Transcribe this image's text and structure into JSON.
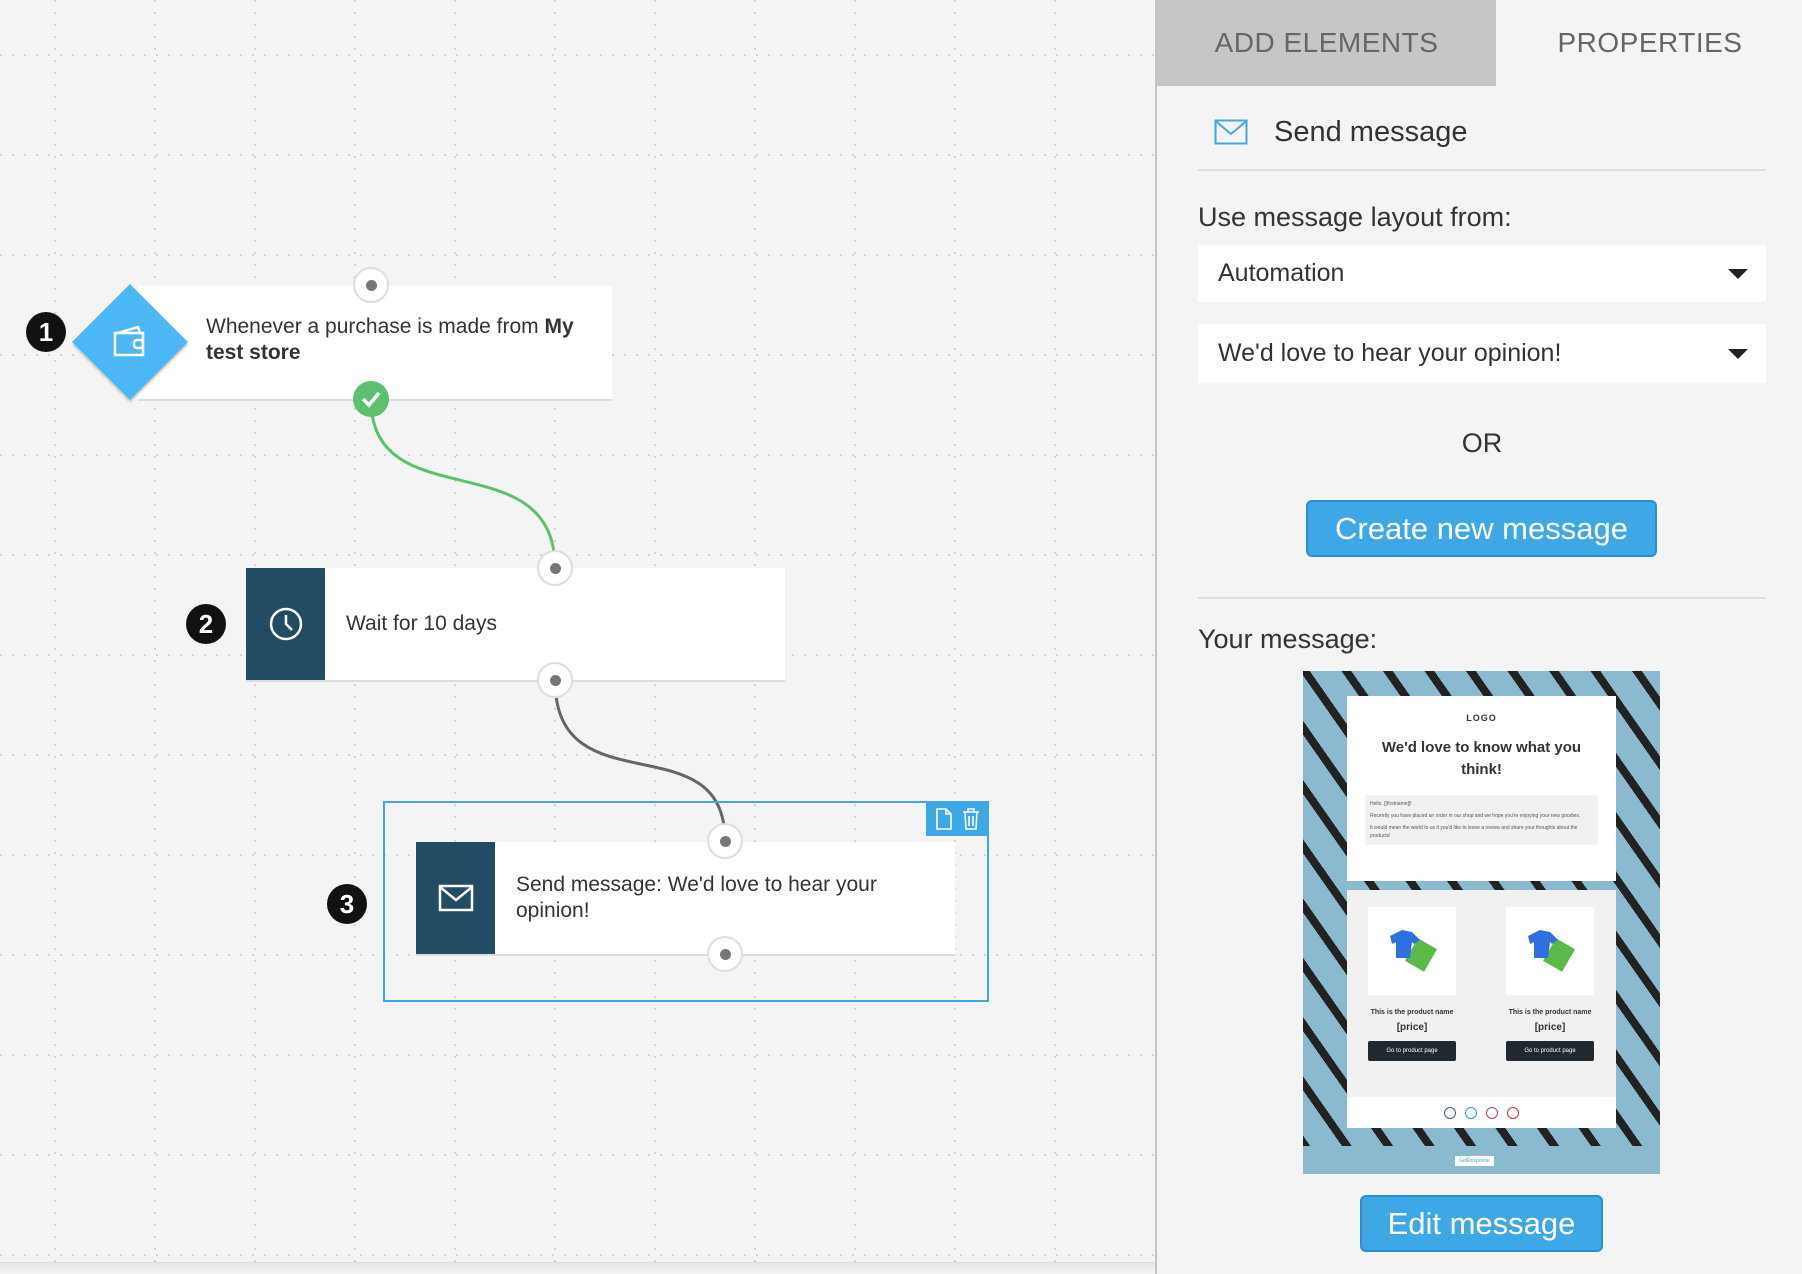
{
  "canvas": {
    "nodes": [
      {
        "number": "1",
        "type": "trigger",
        "text": "Whenever a purchase is made from ",
        "bold": "My test store",
        "icon": "wallet-icon"
      },
      {
        "number": "2",
        "type": "wait",
        "text": "Wait for 10 days",
        "icon": "clock-icon"
      },
      {
        "number": "3",
        "type": "action",
        "text": "Send message: We'd love to hear your opinion!",
        "icon": "envelope-icon",
        "selected": true
      }
    ],
    "colors": {
      "trigger": "#4db6f4",
      "node_icon_bg": "#234b63",
      "success": "#5cc16e",
      "selection": "#3ea8e6"
    }
  },
  "panel": {
    "tabs": [
      {
        "label": "ADD ELEMENTS",
        "active": false
      },
      {
        "label": "PROPERTIES",
        "active": true
      }
    ],
    "header": "Send message",
    "layout_label": "Use message layout from:",
    "layout_source": "Automation",
    "layout_message": "We'd love to hear your opinion!",
    "or": "OR",
    "create_button": "Create new message",
    "your_message": "Your message:",
    "edit_button": "Edit message",
    "preview": {
      "logo": "LOGO",
      "title": "We'd love to know what you think!",
      "greeting": "Hello, [[firstname]]!",
      "para1": "Recently you have placed an order in our shop and we hope you're enjoying your new goodies.",
      "para2": "It would mean the world to us if you'd like to leave a review and share your thoughts about the products!",
      "products": [
        {
          "name": "This is the product name",
          "price": "[price]",
          "button": "Go to product page"
        },
        {
          "name": "This is the product name",
          "price": "[price]",
          "button": "Go to product page"
        }
      ],
      "brand": "GetResponse"
    }
  }
}
